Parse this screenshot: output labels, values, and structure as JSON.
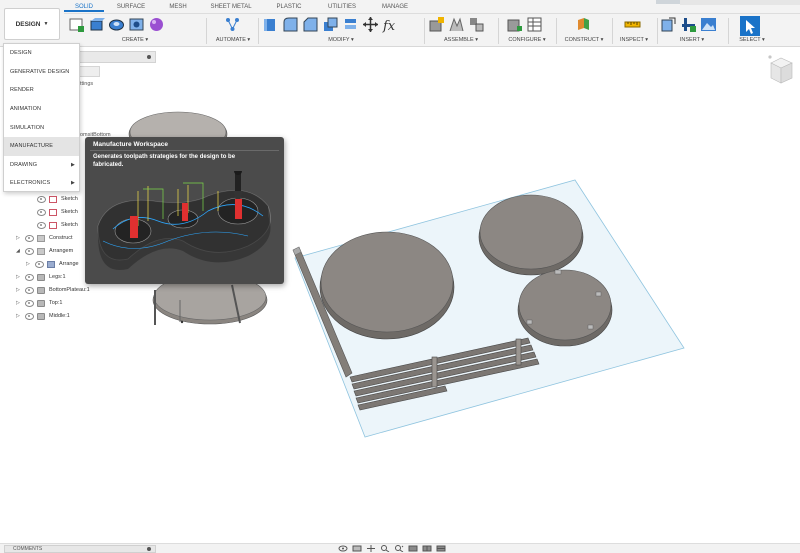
{
  "workspace_button": {
    "label": "DESIGN"
  },
  "tabs": [
    {
      "label": "SOLID",
      "active": true
    },
    {
      "label": "SURFACE"
    },
    {
      "label": "MESH"
    },
    {
      "label": "SHEET METAL"
    },
    {
      "label": "PLASTIC"
    },
    {
      "label": "UTILITIES"
    },
    {
      "label": "MANAGE"
    }
  ],
  "toolbar_groups": [
    {
      "label": "CREATE ▾",
      "icons": [
        "new-sketch-icon",
        "extrude-icon",
        "revolve-icon",
        "hole-icon",
        "form-icon"
      ]
    },
    {
      "label": "AUTOMATE ▾",
      "icons": [
        "automate-icon"
      ]
    },
    {
      "label": "MODIFY ▾",
      "icons": [
        "press-pull-icon",
        "fillet-icon",
        "chamfer-icon",
        "combine-icon",
        "align-icon",
        "move-icon",
        "parameters-icon"
      ]
    },
    {
      "label": "ASSEMBLE ▾",
      "icons": [
        "new-component-icon",
        "joint-icon",
        "as-built-joint-icon"
      ]
    },
    {
      "label": "CONFIGURE ▾",
      "icons": [
        "configure-icon",
        "table-icon"
      ]
    },
    {
      "label": "CONSTRUCT ▾",
      "icons": [
        "plane-icon"
      ]
    },
    {
      "label": "INSPECT ▾",
      "icons": [
        "measure-icon"
      ]
    },
    {
      "label": "INSERT ▾",
      "icons": [
        "insert-derive-icon",
        "insert-mesh-icon",
        "insert-canvas-icon"
      ]
    },
    {
      "label": "SELECT ▾",
      "icons": [
        "select-icon"
      ]
    }
  ],
  "workspace_menu": {
    "items": [
      {
        "label": "DESIGN"
      },
      {
        "label": "GENERATIVE DESIGN"
      },
      {
        "label": "RENDER"
      },
      {
        "label": "ANIMATION"
      },
      {
        "label": "SIMULATION"
      },
      {
        "label": "MANUFACTURE",
        "highlighted": true
      },
      {
        "label": "DRAWING",
        "submenu": true
      },
      {
        "label": "ELECTRONICS",
        "submenu": true
      }
    ]
  },
  "tooltip": {
    "title": "Manufacture Workspace",
    "description": "Generates toolpath strategies for the design to be fabricated."
  },
  "browser": {
    "partials": [
      "ttings",
      "omsitBottom"
    ],
    "rows": [
      {
        "label": "Sketch",
        "type": "sketch"
      },
      {
        "label": "Sketch",
        "type": "sketch"
      },
      {
        "label": "Sketch",
        "type": "sketch"
      },
      {
        "label": "Construct",
        "type": "folder",
        "expand": "▷"
      },
      {
        "label": "Arrangem",
        "type": "folder",
        "expand": "◢"
      },
      {
        "label": "Arrange",
        "type": "arr",
        "expand": "▷"
      },
      {
        "label": "Legs:1",
        "type": "body",
        "expand": "▷"
      },
      {
        "label": "BottomPlateau:1",
        "type": "body",
        "expand": "▷"
      },
      {
        "label": "Top:1",
        "type": "body",
        "expand": "▷"
      },
      {
        "label": "Middle:1",
        "type": "body",
        "expand": "▷"
      }
    ]
  },
  "bottom": {
    "comments_label": "COMMENTS"
  },
  "colors": {
    "accent": "#1a73c8",
    "tooltip_bg": "#4b4b4b",
    "part": "#7a7570",
    "sheet": "#dcecf5"
  }
}
